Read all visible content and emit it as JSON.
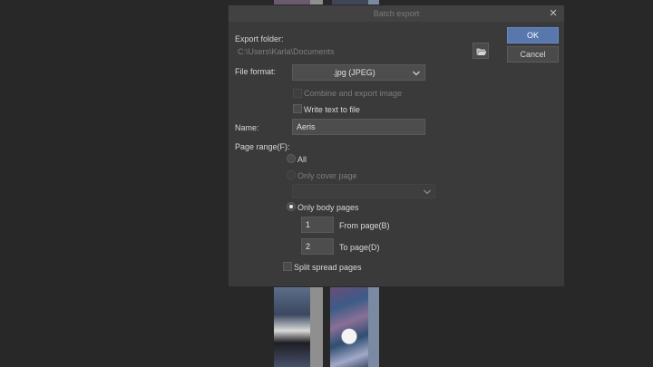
{
  "dialog": {
    "title": "Batch export",
    "close_glyph": "✕",
    "ok_label": "OK",
    "cancel_label": "Cancel"
  },
  "export_folder": {
    "label": "Export folder:",
    "path": "C:\\Users\\Karla\\Documents",
    "browse_icon": "folder-open-icon"
  },
  "file_format": {
    "label": "File format:",
    "selected": ".jpg (JPEG)",
    "combine_label": "Combine and export image",
    "combine_enabled": false,
    "write_text_label": "Write text to file",
    "write_text_checked": false
  },
  "name": {
    "label": "Name:",
    "value": "Aeris"
  },
  "page_range": {
    "label": "Page range(F):",
    "all_label": "All",
    "only_cover_label": "Only cover page",
    "cover_select_value": "",
    "only_body_label": "Only body pages",
    "selected": "only_body",
    "from_value": "1",
    "from_label": "From page(B)",
    "to_value": "2",
    "to_label": "To page(D)",
    "split_label": "Split spread pages",
    "split_checked": false
  },
  "colors": {
    "dialog_bg": "#3a3a3a",
    "accent": "#5877ad",
    "app_bg": "#282828"
  }
}
